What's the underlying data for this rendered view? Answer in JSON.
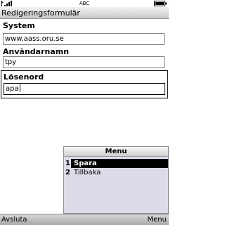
{
  "statusbar": {
    "signal_icon": "signal-strength-icon",
    "input_mode": "ABC",
    "battery_icon": "battery-icon"
  },
  "title": "Redigeringsformulär",
  "form": {
    "fields": [
      {
        "label": "System",
        "value": "www.aass.oru.se"
      },
      {
        "label": "Användarnamn",
        "value": "tpy"
      },
      {
        "label": "Lösenord",
        "value": "apa"
      }
    ]
  },
  "menu": {
    "title": "Menu",
    "items": [
      {
        "number": "1",
        "label": "Spara"
      },
      {
        "number": "2",
        "label": "Tillbaka"
      }
    ],
    "selected_color": "#000000",
    "background_color": "#dcdce8"
  },
  "softkeys": {
    "left": "Avsluta",
    "right": "Menu"
  }
}
